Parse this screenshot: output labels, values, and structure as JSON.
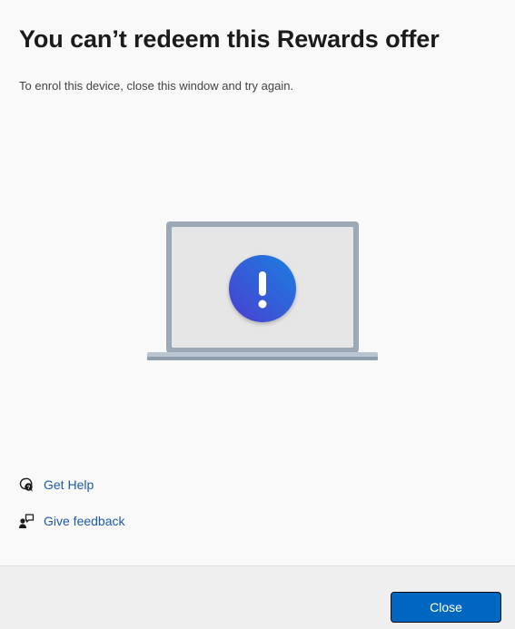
{
  "dialog": {
    "title": "You can’t redeem this Rewards offer",
    "subtitle": "To enrol this device, close this window and try again."
  },
  "illustration": {
    "icon": "laptop-with-exclamation-icon",
    "alert_color": "#3c5fd6"
  },
  "links": [
    {
      "label": "Get Help",
      "icon": "get-help-icon"
    },
    {
      "label": "Give feedback",
      "icon": "feedback-icon"
    }
  ],
  "footer": {
    "close_label": "Close"
  },
  "colors": {
    "accent": "#0067c0",
    "link": "#1e5aa8"
  }
}
